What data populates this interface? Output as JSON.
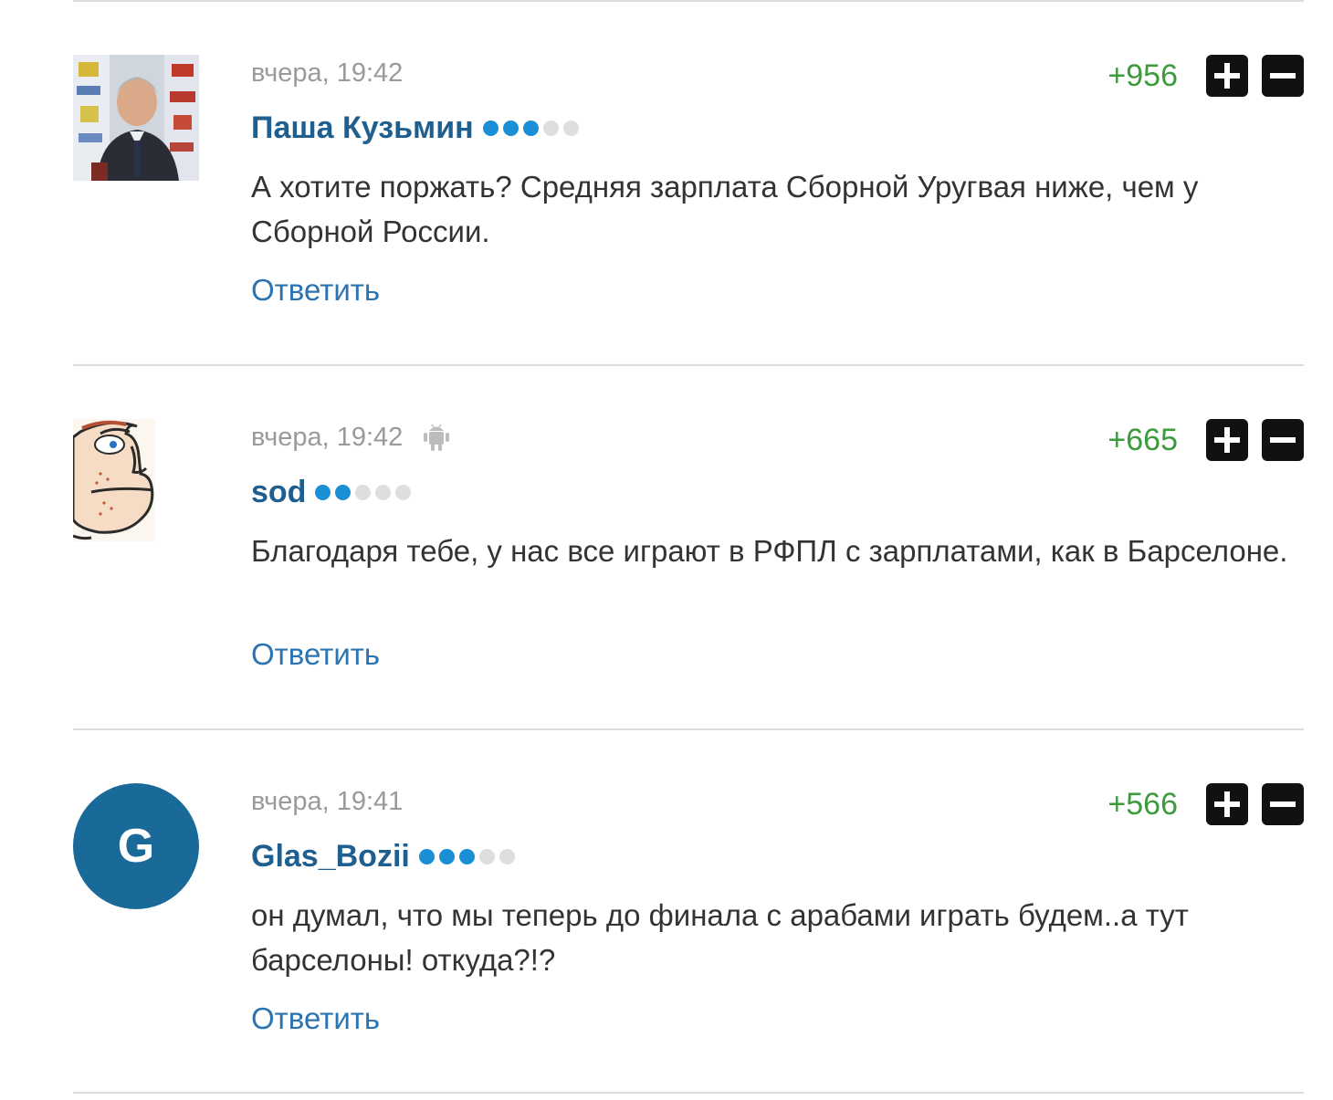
{
  "comments": [
    {
      "timestamp": "вчера, 19:42",
      "author": "Паша Кузьмин",
      "rank_filled": 3,
      "rank_total": 5,
      "score": "+956",
      "text": "А хотите поржать? Средняя зарплата Сборной Уругвая ниже, чем у Сборной России.",
      "reply_label": "Ответить",
      "avatar": "photo",
      "device_icon": null
    },
    {
      "timestamp": "вчера, 19:42",
      "author": "sod",
      "rank_filled": 2,
      "rank_total": 5,
      "score": "+665",
      "text": "Благодаря тебе, у нас все играют в РФПЛ с зарплатами, как в Барселоне.",
      "reply_label": "Ответить",
      "avatar": "sketch",
      "device_icon": "android-icon"
    },
    {
      "timestamp": "вчера, 19:41",
      "author": "Glas_Bozii",
      "rank_filled": 3,
      "rank_total": 5,
      "score": "+566",
      "text": "он думал, что мы теперь до финала с арабами играть будем..а тут барселоны! откуда?!?",
      "reply_label": "Ответить",
      "avatar": "letter",
      "avatar_letter": "G",
      "avatar_color": "#1a6a99",
      "device_icon": null
    }
  ],
  "colors": {
    "author": "#1f5f90",
    "rank_on": "#1a8fd6",
    "rank_off": "#dedede",
    "score": "#3d9b3d",
    "vote_button": "#111111",
    "reply": "#2a74b2"
  },
  "icons": {
    "upvote": "plus-icon",
    "downvote": "minus-icon"
  }
}
